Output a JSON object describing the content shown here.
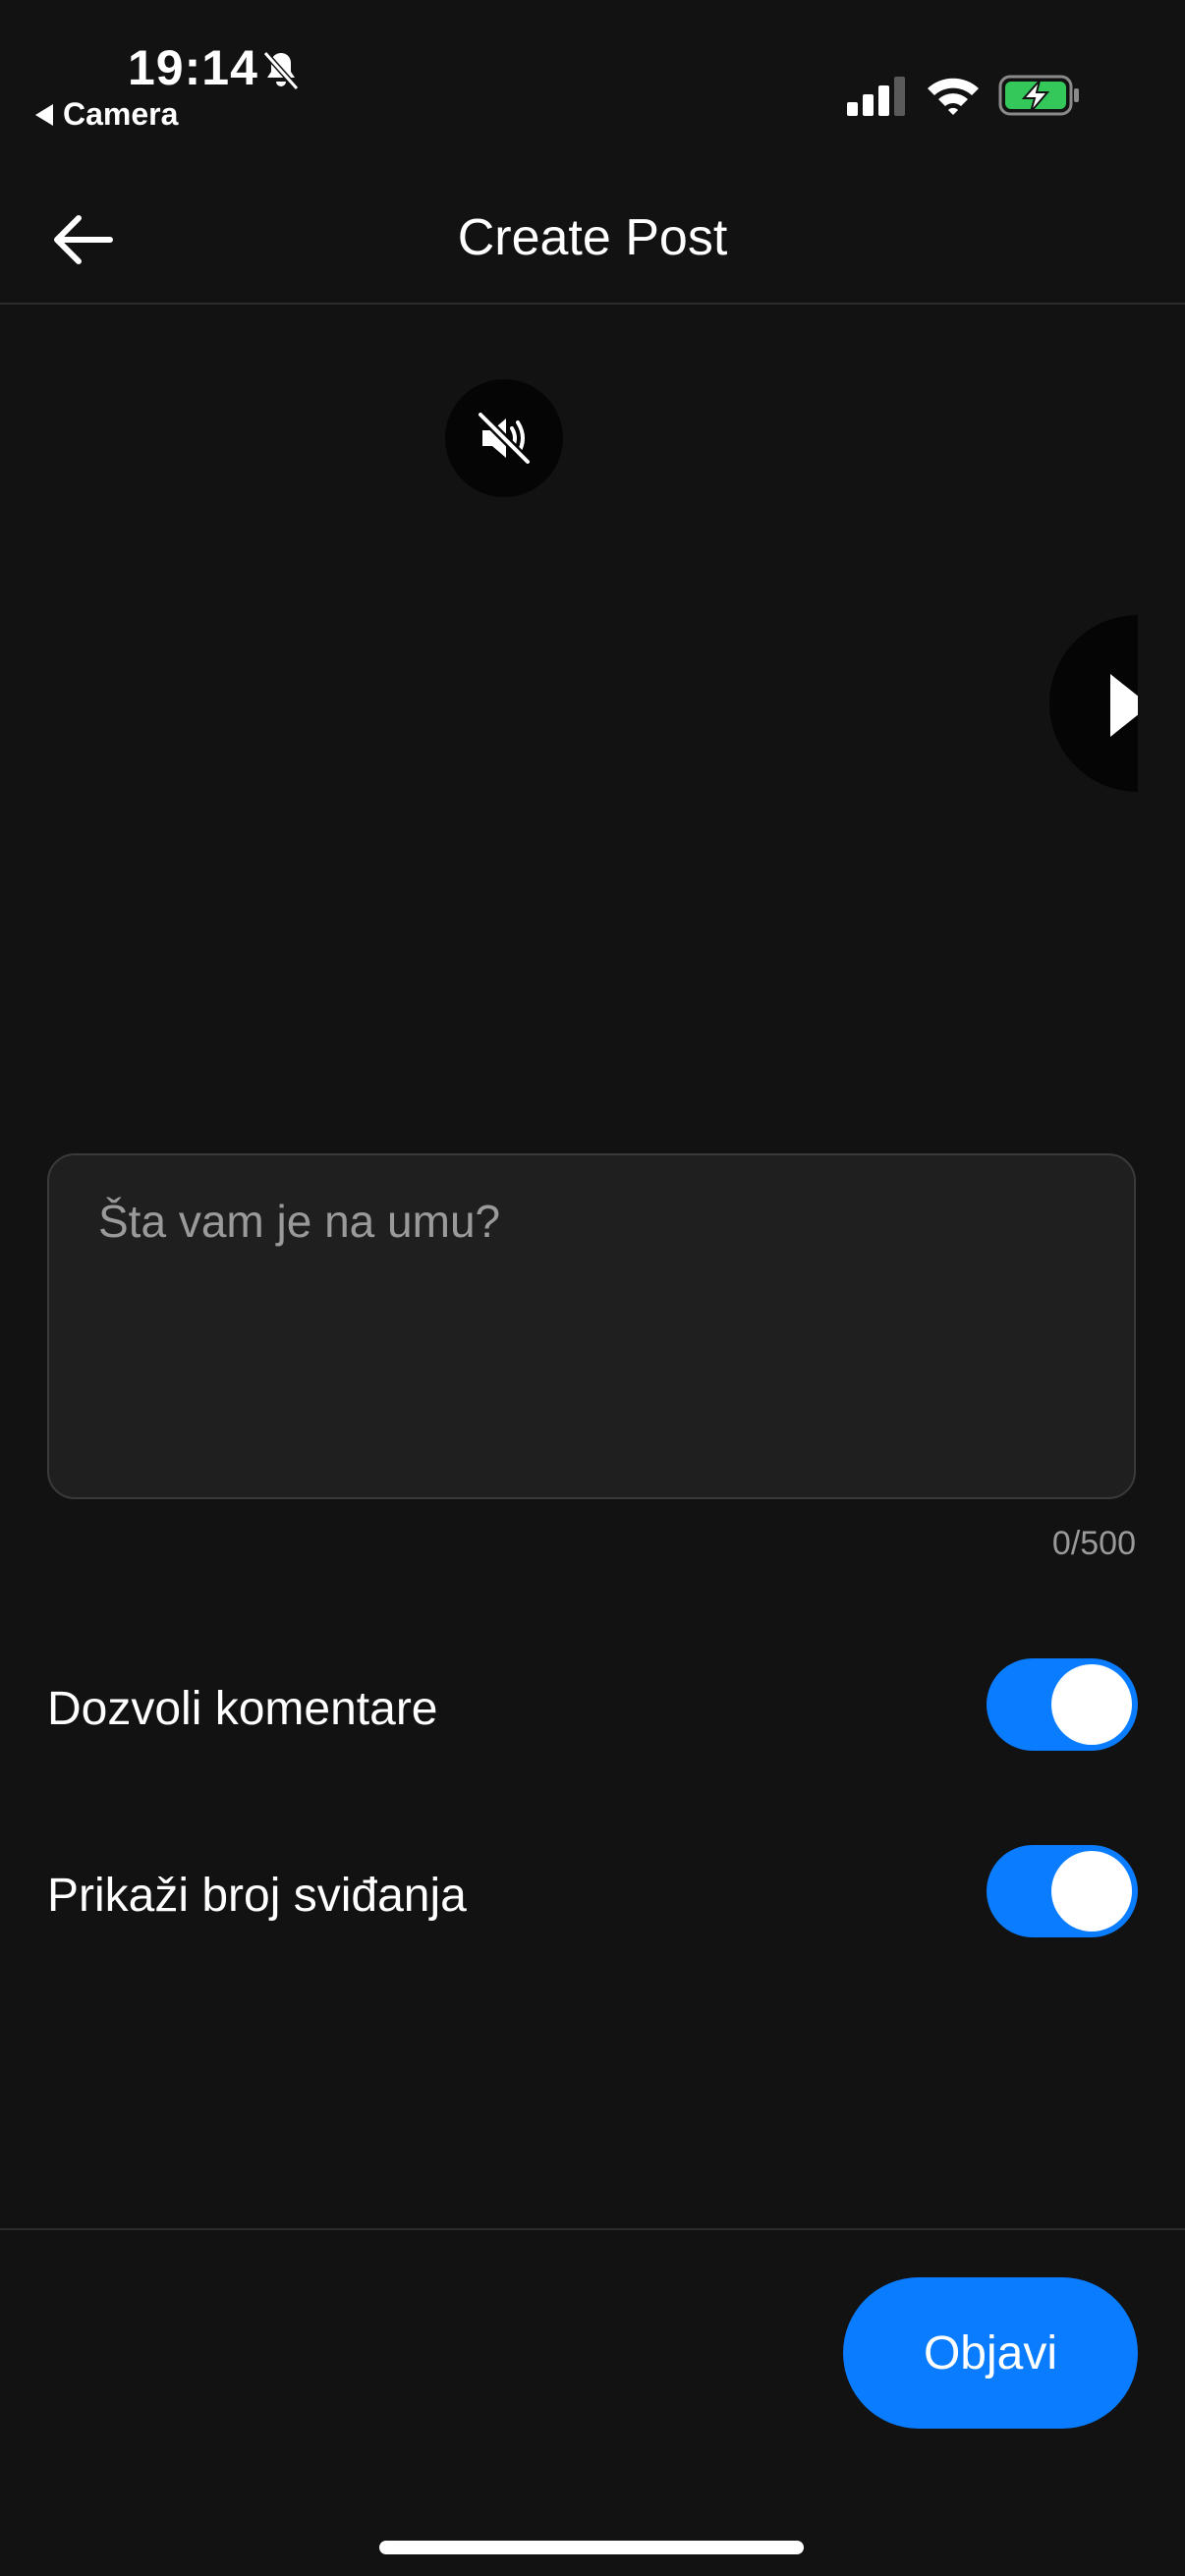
{
  "status_bar": {
    "time": "19:14",
    "back_app_label": "Camera",
    "icons": [
      "bell-slash-icon",
      "cellular-signal-icon",
      "wifi-icon",
      "battery-charging-icon"
    ],
    "battery_color": "#34c759"
  },
  "header": {
    "title": "Create Post",
    "back_icon": "arrow-left-icon"
  },
  "media": {
    "mute_icon": "speaker-muted-icon",
    "next_icon": "play-icon"
  },
  "caption": {
    "placeholder": "Šta vam je na umu?",
    "value": "",
    "counter": "0/500"
  },
  "settings": {
    "allow_comments": {
      "label": "Dozvoli komentare",
      "enabled": true
    },
    "show_likes": {
      "label": "Prikaži broj sviđanja",
      "enabled": true
    }
  },
  "footer": {
    "publish_label": "Objavi"
  },
  "colors": {
    "background": "#121212",
    "accent": "#0a7cff",
    "input_background": "#1f1f1f",
    "muted_text": "#9a9a9a"
  }
}
